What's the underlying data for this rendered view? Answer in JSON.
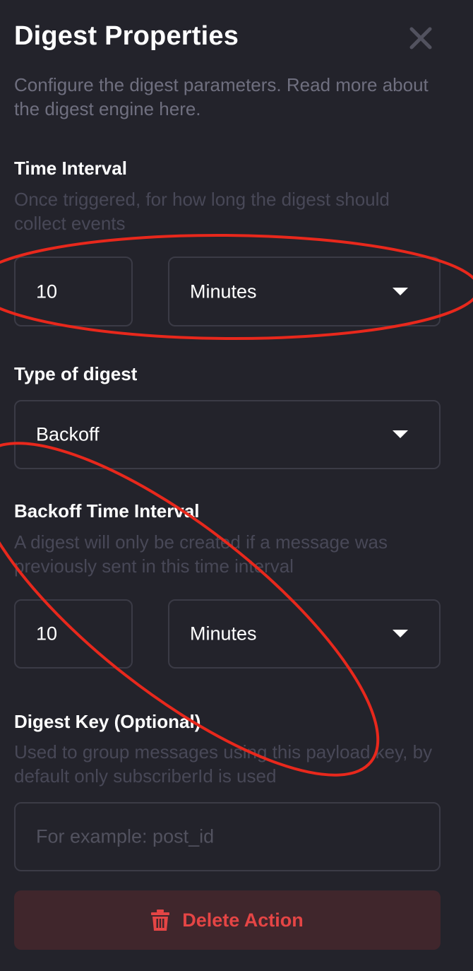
{
  "header": {
    "title": "Digest Properties",
    "description": "Configure the digest parameters. Read more about the digest engine here."
  },
  "time_interval": {
    "label": "Time Interval",
    "hint": "Once triggered, for how long the digest should collect events",
    "amount": "10",
    "unit": "Minutes"
  },
  "digest_type": {
    "label": "Type of digest",
    "value": "Backoff"
  },
  "backoff_interval": {
    "label": "Backoff Time Interval",
    "hint": "A digest will only be created if a message was previously sent in this time interval",
    "amount": "10",
    "unit": "Minutes"
  },
  "digest_key": {
    "label": "Digest Key (Optional)",
    "hint": "Used to group messages using this payload key, by default only subscriberId is used",
    "placeholder": "For example: post_id"
  },
  "actions": {
    "delete_label": "Delete Action"
  },
  "colors": {
    "background": "#23232b",
    "danger": "#e54545",
    "annotation": "#e8281c"
  }
}
